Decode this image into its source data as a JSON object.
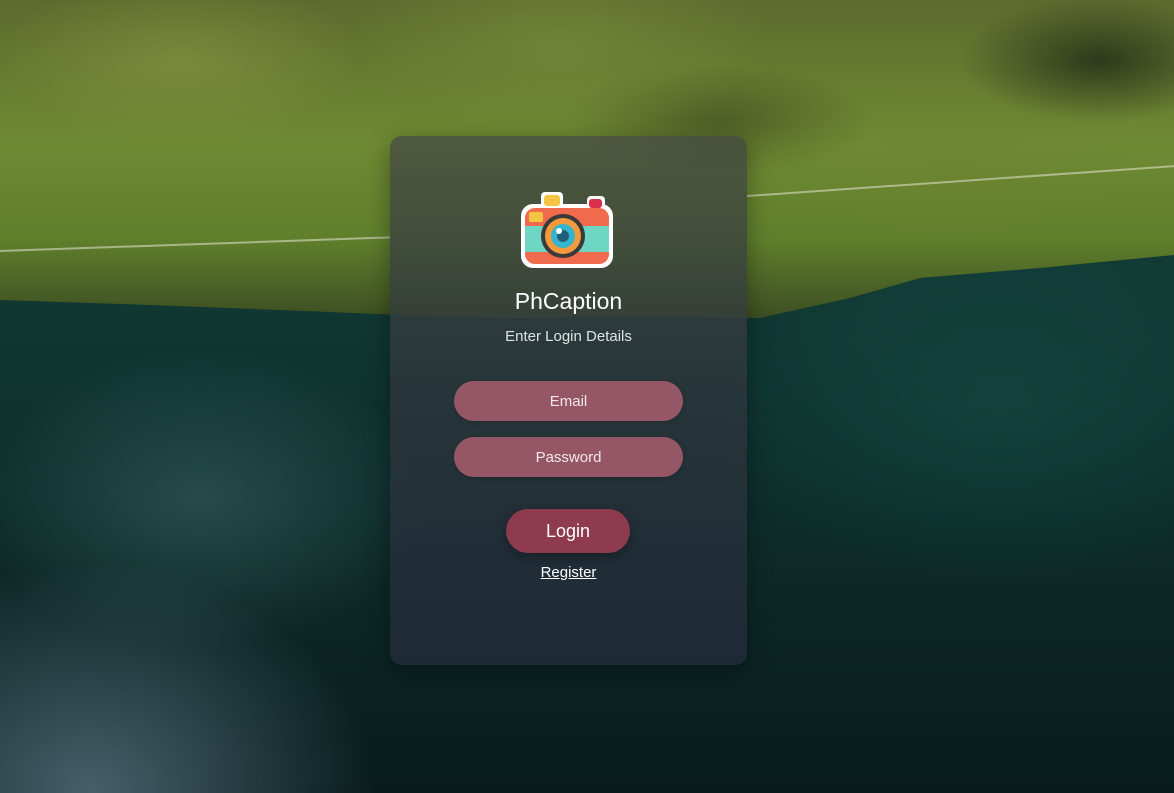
{
  "app": {
    "title": "PhCaption",
    "subtitle": "Enter Login Details",
    "logo_icon": "camera-icon"
  },
  "form": {
    "email_placeholder": "Email",
    "password_placeholder": "Password",
    "login_label": "Login",
    "register_label": "Register"
  },
  "colors": {
    "field_bg": "#955766",
    "button_bg": "#8e3a4f",
    "card_bg": "#1f2a38"
  }
}
